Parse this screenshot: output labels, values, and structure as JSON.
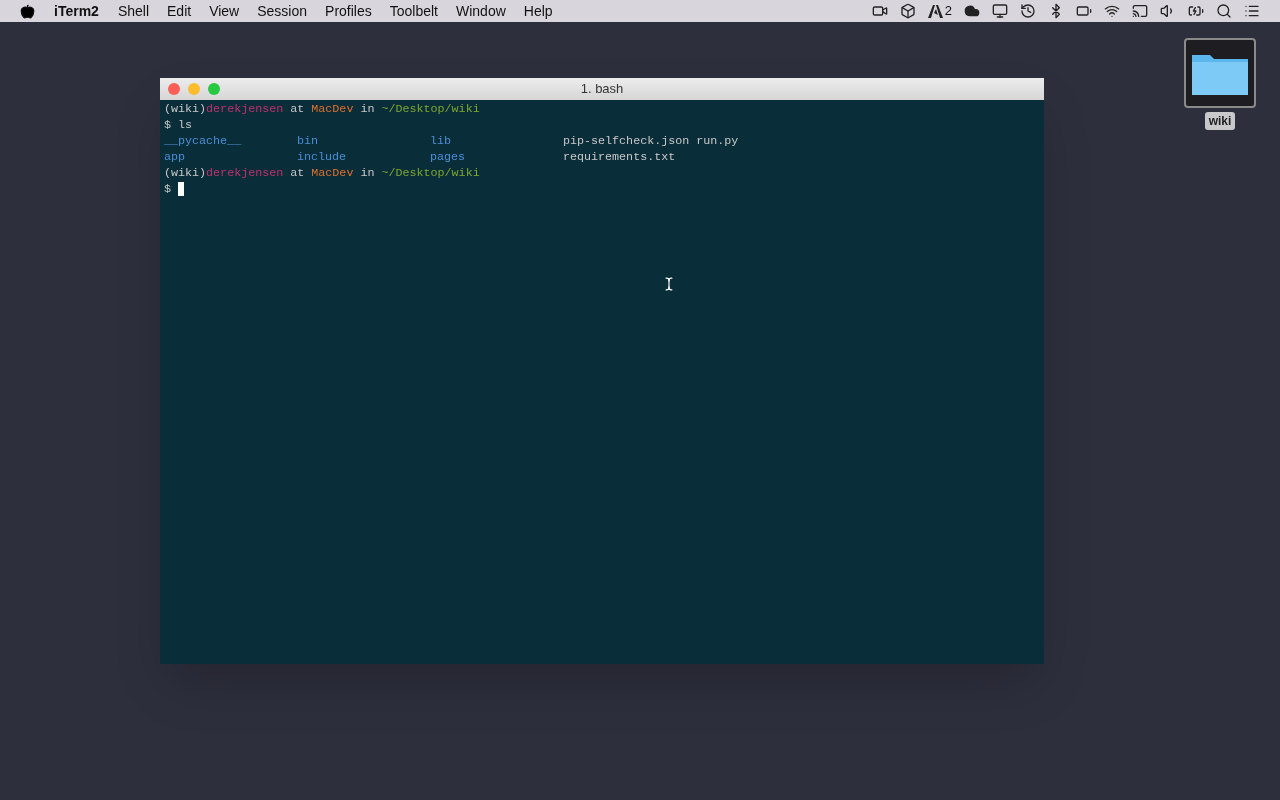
{
  "menubar": {
    "menus": [
      {
        "label": "iTerm2",
        "kind": "app"
      },
      {
        "label": "Shell",
        "kind": "menu"
      },
      {
        "label": "Edit",
        "kind": "menu"
      },
      {
        "label": "View",
        "kind": "menu"
      },
      {
        "label": "Session",
        "kind": "menu"
      },
      {
        "label": "Profiles",
        "kind": "menu"
      },
      {
        "label": "Toolbelt",
        "kind": "menu"
      },
      {
        "label": "Window",
        "kind": "menu"
      },
      {
        "label": "Help",
        "kind": "menu"
      }
    ],
    "adobe_badge": "2"
  },
  "window": {
    "title": "1. bash"
  },
  "terminal": {
    "lines": [
      {
        "kind": "text",
        "segments": [
          {
            "text": "(wiki)",
            "kind": "plain"
          },
          {
            "text": "derekjensen",
            "kind": "user"
          },
          {
            "text": " at ",
            "kind": "plain"
          },
          {
            "text": "MacDev",
            "kind": "host"
          },
          {
            "text": " in ",
            "kind": "plain"
          },
          {
            "text": "~/Desktop/wiki",
            "kind": "path"
          }
        ],
        "cursor": false
      },
      {
        "kind": "text",
        "segments": [
          {
            "text": "$ ls",
            "kind": "plain"
          }
        ],
        "cursor": false
      },
      {
        "kind": "listing",
        "cells": [
          {
            "text": "__pycache__",
            "kind": "directory"
          },
          {
            "text": "bin",
            "kind": "directory"
          },
          {
            "text": "lib",
            "kind": "directory"
          },
          {
            "text": "pip-selfcheck.json run.py",
            "kind": "file"
          }
        ]
      },
      {
        "kind": "listing",
        "cells": [
          {
            "text": "app",
            "kind": "directory"
          },
          {
            "text": "include",
            "kind": "directory"
          },
          {
            "text": "pages",
            "kind": "directory"
          },
          {
            "text": "requirements.txt",
            "kind": "file"
          }
        ]
      },
      {
        "kind": "text",
        "segments": [
          {
            "text": "(wiki)",
            "kind": "plain"
          },
          {
            "text": "derekjensen",
            "kind": "user"
          },
          {
            "text": " at ",
            "kind": "plain"
          },
          {
            "text": "MacDev",
            "kind": "host"
          },
          {
            "text": " in ",
            "kind": "plain"
          },
          {
            "text": "~/Desktop/wiki",
            "kind": "path"
          }
        ],
        "cursor": false
      },
      {
        "kind": "text",
        "segments": [
          {
            "text": "$",
            "kind": "plain"
          }
        ],
        "cursor": true
      }
    ]
  },
  "desktop": {
    "folder": {
      "label": "wiki",
      "selected": true
    }
  }
}
